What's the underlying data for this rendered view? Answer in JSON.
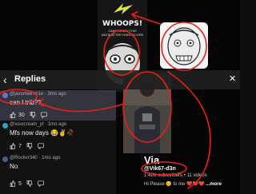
{
  "meme": {
    "title": "WHOOPS!",
    "subtitle": "CAN'T SHOW THIS ANTIMATTER HOROSCOPE"
  },
  "replies": {
    "title": "Replies",
    "back_icon": "chevron-left-icon",
    "close_icon": "close-icon",
    "comments": [
      {
        "author": "@jaxonlee-m1e",
        "time": "3mo ago",
        "text": "can I trib??",
        "likes": "30",
        "avatar_color": "#7a6cc9"
      },
      {
        "author": "@sourcream_yt",
        "time": "1mo ago",
        "text": "Mfs now days 😂✌️🥀",
        "likes": "7",
        "avatar_color": "#2fa3c7"
      },
      {
        "author": "@Rockvr340",
        "time": "1mo ago",
        "text": "No",
        "likes": "5",
        "avatar_color": "#4a5d8a"
      }
    ]
  },
  "channel": {
    "name": "Via",
    "handle": "@Vik67-d3n",
    "stats": "1.42K subscribers • 11 videos",
    "description": "Hi Please 😊 to me ❤️❤️❤️",
    "more": "...more"
  },
  "colors": {
    "annotation": "#e8201a",
    "panel_highlight": "#37373f"
  }
}
